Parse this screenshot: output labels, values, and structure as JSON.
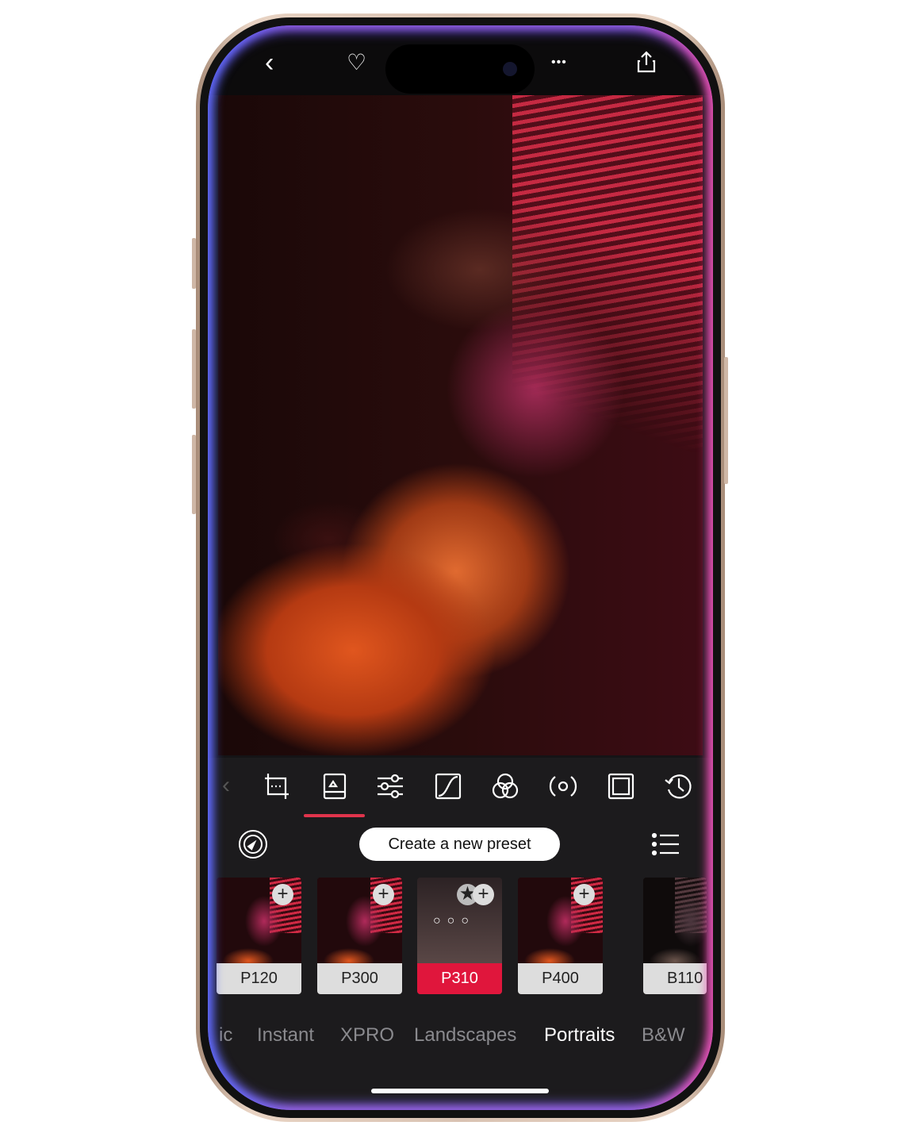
{
  "topbar": {
    "back": "‹",
    "favorite": "♡",
    "more": "•••",
    "share": "share-icon"
  },
  "toolbar": {
    "items": [
      "crop",
      "presets",
      "adjust",
      "curves",
      "color-mixer",
      "hsl",
      "frame",
      "history"
    ],
    "active": "presets",
    "accent": "#e0344c"
  },
  "preset_bar": {
    "create_label": "Create a new preset"
  },
  "presets": [
    {
      "label": "P120",
      "selected": false
    },
    {
      "label": "P300",
      "selected": false
    },
    {
      "label": "P310",
      "selected": true
    },
    {
      "label": "P400",
      "selected": false
    },
    {
      "label": "B110",
      "selected": false
    }
  ],
  "categories": [
    {
      "label": "ic",
      "active": false
    },
    {
      "label": "Instant",
      "active": false
    },
    {
      "label": "XPRO",
      "active": false
    },
    {
      "label": "Landscapes",
      "active": false
    },
    {
      "label": "Portraits",
      "active": true
    },
    {
      "label": "B&W",
      "active": false
    }
  ]
}
